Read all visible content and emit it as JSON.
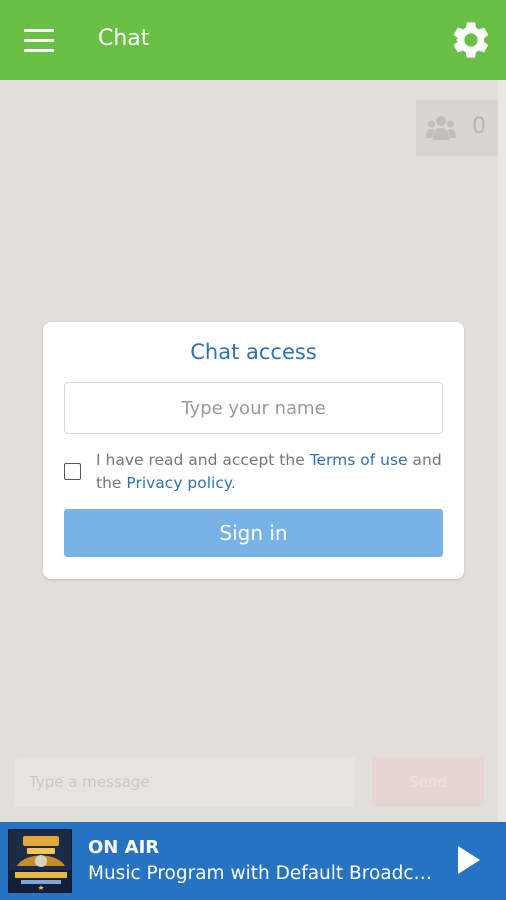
{
  "app_bar": {
    "title": "Chat",
    "menu_icon": "hamburger-menu-icon",
    "settings_icon": "gear-icon",
    "color": "#6abf47"
  },
  "users_online": {
    "icon": "users-group-icon",
    "count": "0"
  },
  "chat_access": {
    "title": "Chat access",
    "name_placeholder": "Type your name",
    "checkbox_checked": false,
    "terms_prefix": "I have read and accept the",
    "terms_link": "Terms of use",
    "terms_middle": "and the",
    "privacy_link": "Privacy policy",
    "terms_suffix": ".",
    "sign_in_label": "Sign in",
    "accent": "#2f72b8",
    "button_color": "#79b2e5"
  },
  "composer": {
    "placeholder": "Type a message",
    "send_label": "Send"
  },
  "player": {
    "status": "ON AIR",
    "program": "Music Program with Default Broadcaster",
    "play_icon": "play-icon",
    "color": "#2674c1"
  }
}
